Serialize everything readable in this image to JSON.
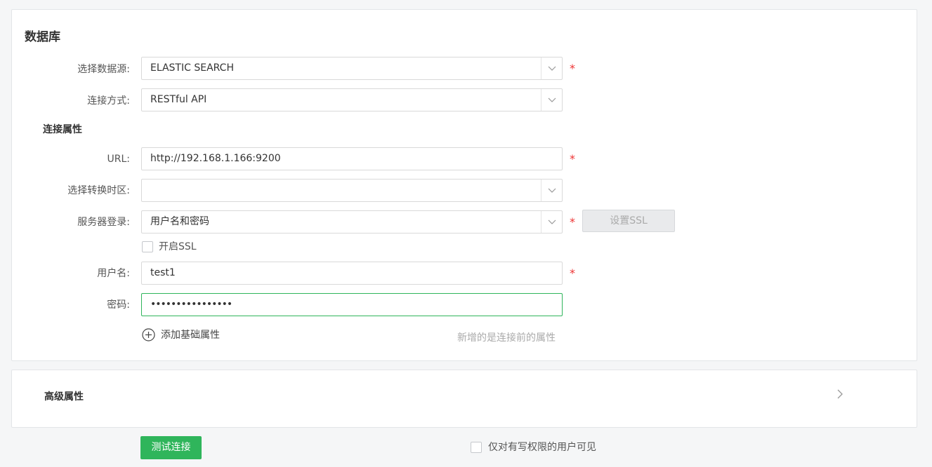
{
  "database": {
    "title": "数据库",
    "datasource_label": "选择数据源:",
    "datasource_value": "ELASTIC SEARCH",
    "connection_label": "连接方式:",
    "connection_value": "RESTful API",
    "props_title": "连接属性",
    "url_label": "URL:",
    "url_value": "http://192.168.1.166:9200",
    "timezone_label": "选择转换时区:",
    "timezone_value": "",
    "server_login_label": "服务器登录:",
    "server_login_value": "用户名和密码",
    "ssl_button": "设置SSL",
    "enable_ssl_label": "开启SSL",
    "username_label": "用户名:",
    "username_value": "test1",
    "password_label": "密码:",
    "password_value": "••••••••••••••••",
    "add_prop_label": "添加基础属性",
    "add_prop_hint": "新增的是连接前的属性",
    "required_mark": "*"
  },
  "advanced": {
    "title": "高级属性"
  },
  "footer": {
    "test_button": "测试连接",
    "visibility_label": "仅对有写权限的用户可见"
  },
  "colors": {
    "accent": "#2fb55b",
    "required": "#e33333"
  }
}
